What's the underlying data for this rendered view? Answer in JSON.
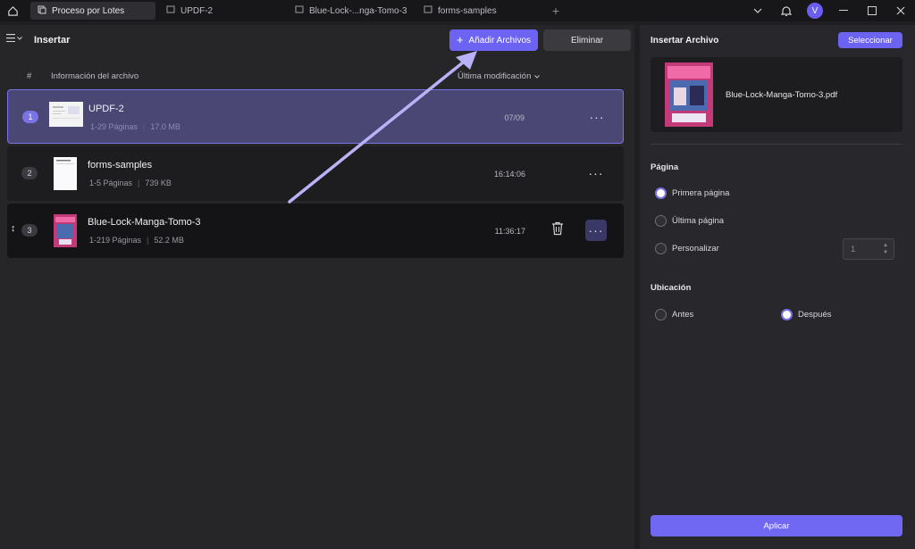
{
  "titlebar": {
    "tabs": [
      {
        "label": "Proceso por Lotes",
        "active": true
      },
      {
        "label": "UPDF-2",
        "active": false
      },
      {
        "label": "Blue-Lock-...nga-Tomo-3",
        "active": false
      },
      {
        "label": "forms-samples",
        "active": false
      }
    ],
    "avatar_initial": "V"
  },
  "left": {
    "title": "Insertar",
    "add_button": "Añadir Archivos",
    "delete_button": "Eliminar",
    "columns": {
      "num": "#",
      "info": "Información del archivo",
      "modified": "Última modificación"
    },
    "rows": [
      {
        "num": "1",
        "name": "UPDF-2",
        "pages": "1-29 Páginas",
        "size": "17.0 MB",
        "time": "07/09"
      },
      {
        "num": "2",
        "name": "forms-samples",
        "pages": "1-5 Páginas",
        "size": "739 KB",
        "time": "16:14:06"
      },
      {
        "num": "3",
        "name": "Blue-Lock-Manga-Tomo-3",
        "pages": "1-219 Páginas",
        "size": "52.2 MB",
        "time": "11:36:17"
      }
    ]
  },
  "right": {
    "title": "Insertar Archivo",
    "select_button": "Seleccionar",
    "file_name": "Blue-Lock-Manga-Tomo-3.pdf",
    "page_section": "Página",
    "page_options": [
      "Primera página",
      "Última página",
      "Personalizar"
    ],
    "page_selected": "Primera página",
    "custom_value": "1",
    "location_section": "Ubicación",
    "location_options": [
      "Antes",
      "Después"
    ],
    "location_selected": "Después",
    "apply_button": "Aplicar"
  },
  "colors": {
    "accent": "#6d63f2",
    "background": "#1f1f22"
  }
}
